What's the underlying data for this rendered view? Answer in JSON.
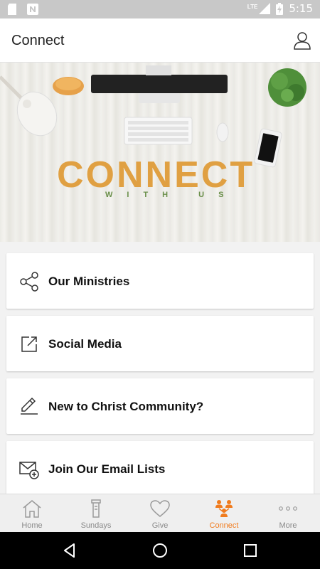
{
  "status_bar": {
    "time": "5:15",
    "network_label": "LTE",
    "icons": [
      "sd-card-icon",
      "n-notification-icon",
      "signal-icon",
      "battery-charging-icon"
    ]
  },
  "app_bar": {
    "title": "Connect",
    "profile_icon": "person-icon"
  },
  "hero": {
    "headline": "CONNECT",
    "subline": "WITH US",
    "headline_color": "#e0a042",
    "subline_color": "#6a8f4a"
  },
  "menu": {
    "items": [
      {
        "label": "Our Ministries",
        "icon": "share-icon"
      },
      {
        "label": "Social Media",
        "icon": "external-link-icon"
      },
      {
        "label": "New to Christ Community?",
        "icon": "edit-icon"
      },
      {
        "label": "Join Our Email Lists",
        "icon": "mail-add-icon"
      }
    ]
  },
  "bottom_nav": {
    "active_color": "#f07b1d",
    "items": [
      {
        "label": "Home",
        "icon": "home-icon"
      },
      {
        "label": "Sundays",
        "icon": "pulpit-icon"
      },
      {
        "label": "Give",
        "icon": "heart-icon"
      },
      {
        "label": "Connect",
        "icon": "people-icon",
        "active": true
      },
      {
        "label": "More",
        "icon": "more-dots-icon"
      }
    ]
  }
}
